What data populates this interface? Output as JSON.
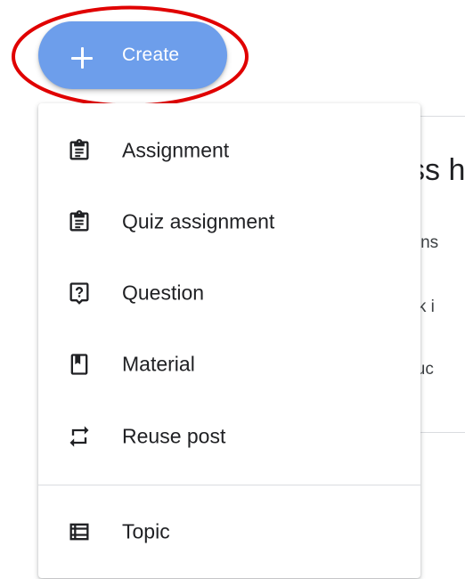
{
  "create_button": {
    "label": "Create",
    "icon": "plus-icon"
  },
  "create_menu": {
    "items": [
      {
        "label": "Assignment",
        "icon": "assignment-icon"
      },
      {
        "label": "Quiz assignment",
        "icon": "quiz-assignment-icon"
      },
      {
        "label": "Question",
        "icon": "question-icon"
      },
      {
        "label": "Material",
        "icon": "material-icon"
      },
      {
        "label": "Reuse post",
        "icon": "repeat-icon"
      }
    ],
    "topic": {
      "label": "Topic",
      "icon": "topic-icon"
    }
  },
  "background_card": {
    "heading": "ss h",
    "lines": [
      "tions",
      "ork i",
      "stuc"
    ]
  },
  "colors": {
    "create_button_bg": "#6d9eeb",
    "highlight_ring": "#e00000",
    "menu_text": "#202124"
  }
}
